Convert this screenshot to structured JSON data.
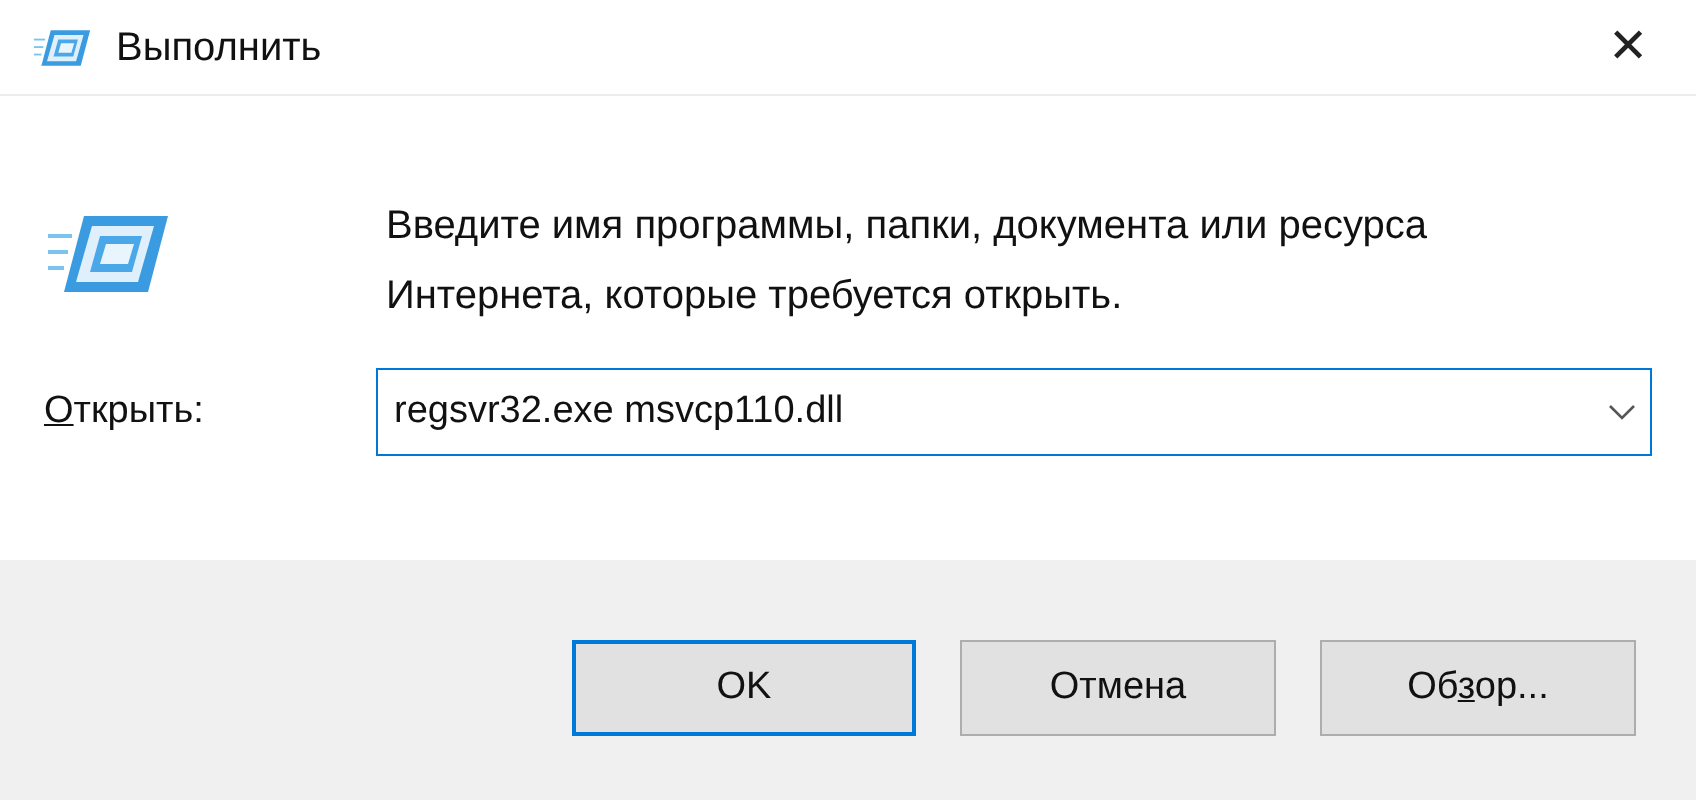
{
  "window": {
    "title": "Выполнить",
    "close": "✕"
  },
  "description": "Введите имя программы, папки, документа или ресурса Интернета, которые требуется открыть.",
  "open_field": {
    "label": {
      "key": "О",
      "after": "ткрыть:"
    },
    "value": "regsvr32.exe msvcp110.dll"
  },
  "buttons": [
    {
      "before": "OK",
      "selected": true
    },
    {
      "before": "Отмена",
      "selected": false
    },
    {
      "before": "Об",
      "key": "з",
      "after": "ор...",
      "selected": false
    }
  ]
}
